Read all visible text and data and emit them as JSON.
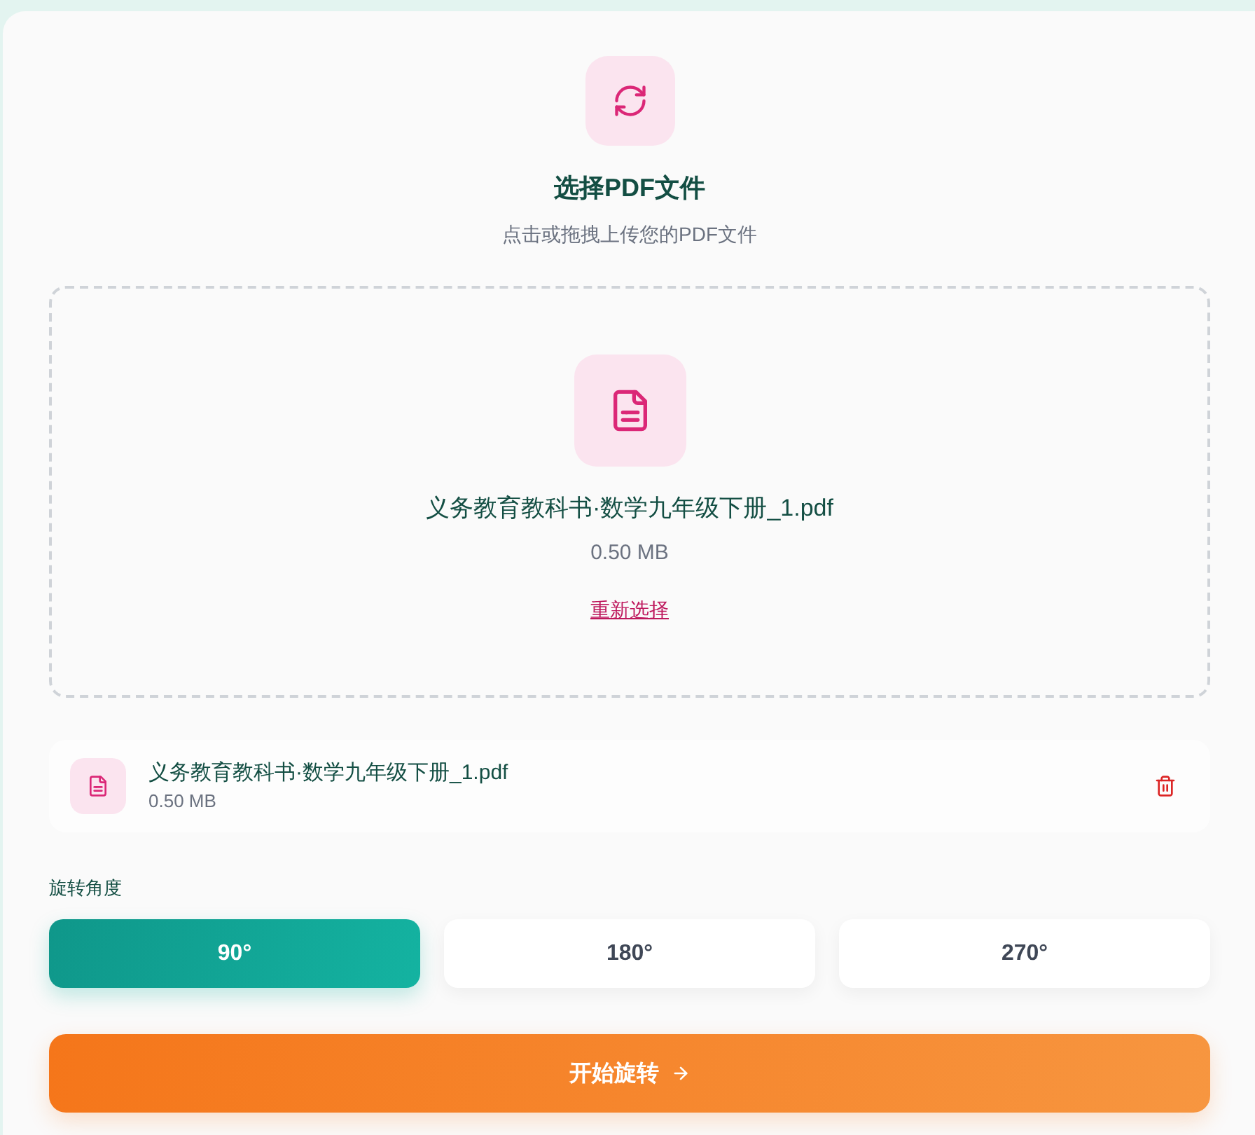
{
  "header": {
    "title": "选择PDF文件",
    "subtitle": "点击或拖拽上传您的PDF文件"
  },
  "dropzone": {
    "file_name": "义务教育教科书·数学九年级下册_1.pdf",
    "file_size": "0.50 MB",
    "reselect_link": "重新选择"
  },
  "file_list": [
    {
      "name": "义务教育教科书·数学九年级下册_1.pdf",
      "size": "0.50 MB"
    }
  ],
  "rotation": {
    "label": "旋转角度",
    "options": [
      {
        "label": "90°",
        "selected": true
      },
      {
        "label": "180°",
        "selected": false
      },
      {
        "label": "270°",
        "selected": false
      }
    ]
  },
  "start_button": {
    "label": "开始旋转"
  }
}
